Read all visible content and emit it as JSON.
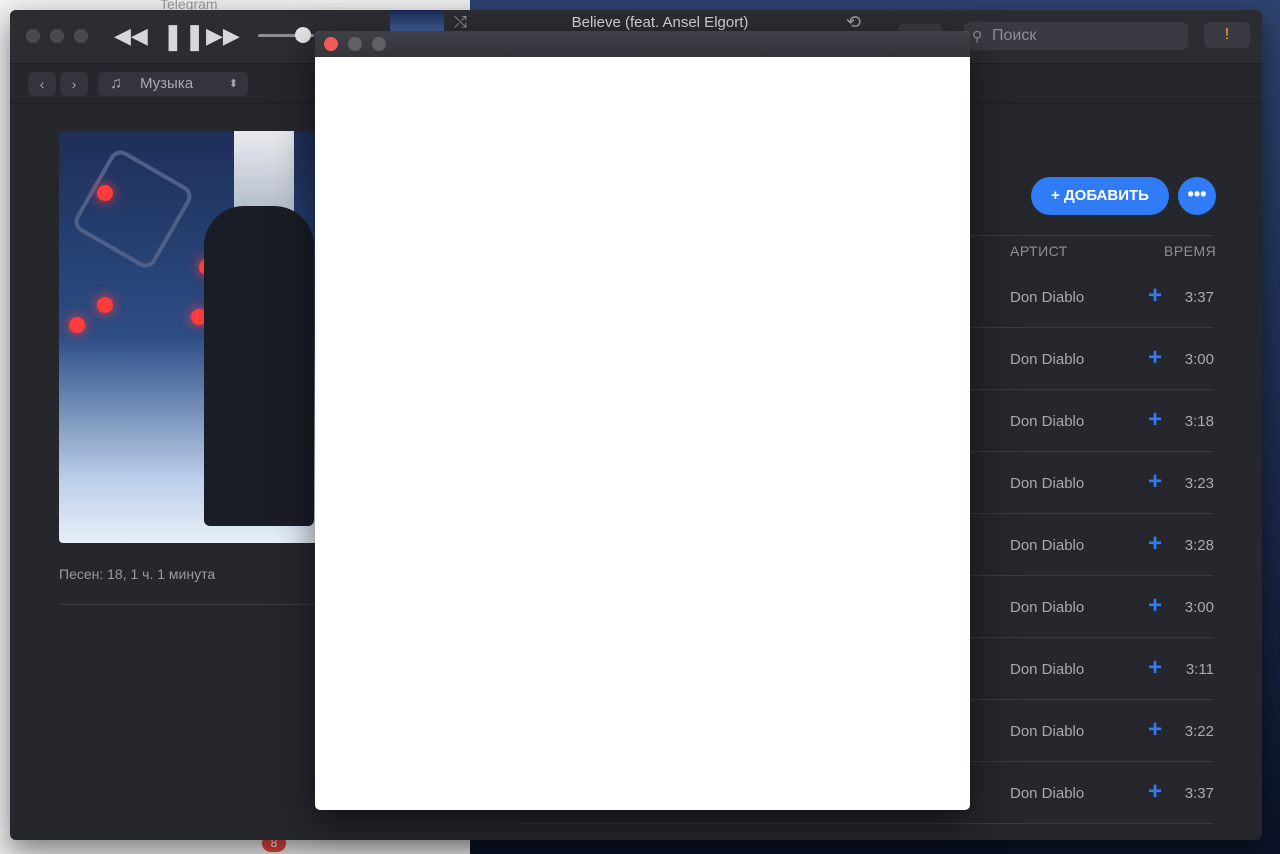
{
  "background": {
    "telegram_title": "Telegram",
    "telegram_badge": "8"
  },
  "player": {
    "now_playing_title": "Believe (feat. Ansel Elgort)",
    "rewind_icon": "◀◀",
    "pause_icon": "❚❚",
    "forward_icon": "▶▶",
    "shuffle_icon": "⤭",
    "repeat_icon": "⟲",
    "volume": 0.8
  },
  "search": {
    "placeholder": "Поиск",
    "icon": "⚲"
  },
  "alert": {
    "icon": "!"
  },
  "toolbar": {
    "back": "‹",
    "forward": "›",
    "source_label": "Музыка",
    "note_icon": "♫",
    "updown_icon": "⬍"
  },
  "album": {
    "meta": "Песен: 18, 1 ч. 1 минута"
  },
  "actions": {
    "add_label": "+ ДОБАВИТЬ",
    "more_label": "•••"
  },
  "columns": {
    "artist": "АРТИСТ",
    "time": "ВРЕМЯ"
  },
  "tracks": [
    {
      "artist": "Don Diablo",
      "add": "+",
      "time": "3:37"
    },
    {
      "artist": "Don Diablo",
      "add": "+",
      "time": "3:00"
    },
    {
      "artist": "Don Diablo",
      "add": "+",
      "time": "3:18"
    },
    {
      "artist": "Don Diablo",
      "add": "+",
      "time": "3:23"
    },
    {
      "artist": "Don Diablo",
      "add": "+",
      "time": "3:28"
    },
    {
      "artist": "Don Diablo",
      "add": "+",
      "time": "3:00"
    },
    {
      "artist": "Don Diablo",
      "add": "+",
      "time": "3:11"
    },
    {
      "artist": "Don Diablo",
      "add": "+",
      "time": "3:22"
    },
    {
      "artist": "Don Diablo",
      "add": "+",
      "time": "3:37"
    }
  ],
  "colors": {
    "accent": "#2f7cf6",
    "window_bg": "#26272d",
    "close": "#f25b55",
    "alert": "#f0a41c"
  }
}
